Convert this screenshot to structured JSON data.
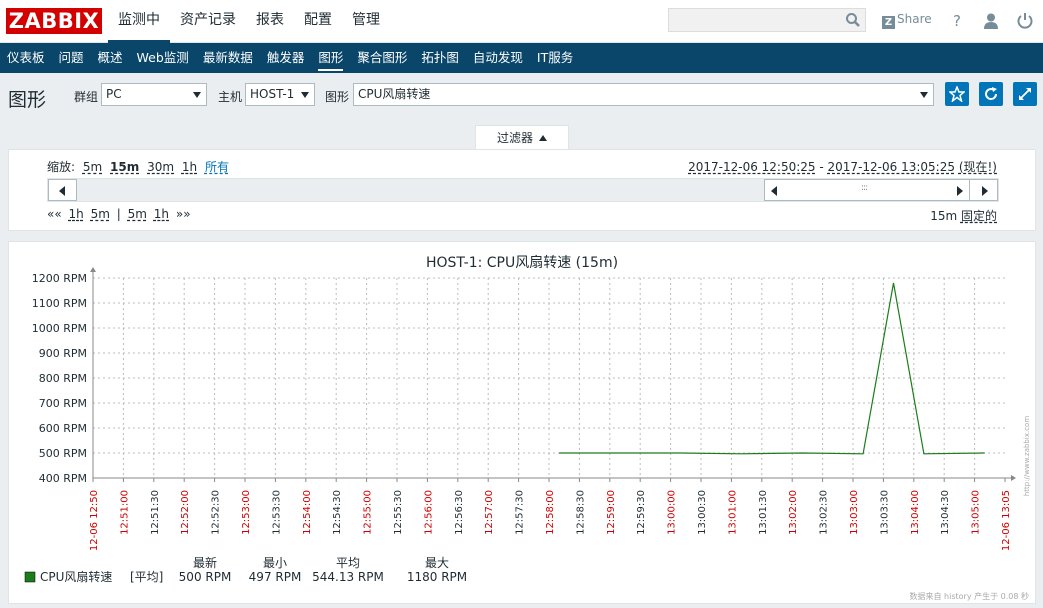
{
  "app": {
    "logo": "ZABBIX",
    "share": "Share",
    "share_badge": "Z"
  },
  "main_menu": [
    {
      "label": "监测中",
      "active": true
    },
    {
      "label": "资产记录",
      "active": false
    },
    {
      "label": "报表",
      "active": false
    },
    {
      "label": "配置",
      "active": false
    },
    {
      "label": "管理",
      "active": false
    }
  ],
  "sub_menu": [
    {
      "label": "仪表板",
      "active": false
    },
    {
      "label": "问题",
      "active": false
    },
    {
      "label": "概述",
      "active": false
    },
    {
      "label": "Web监测",
      "active": false
    },
    {
      "label": "最新数据",
      "active": false
    },
    {
      "label": "触发器",
      "active": false
    },
    {
      "label": "图形",
      "active": true
    },
    {
      "label": "聚合图形",
      "active": false
    },
    {
      "label": "拓扑图",
      "active": false
    },
    {
      "label": "自动发现",
      "active": false
    },
    {
      "label": "IT服务",
      "active": false
    }
  ],
  "header": {
    "title": "图形",
    "group_label": "群组",
    "group_value": "PC",
    "host_label": "主机",
    "host_value": "HOST-1",
    "graph_label": "图形",
    "graph_value": "CPU风扇转速"
  },
  "filter": {
    "tab_label": "过滤器",
    "zoom_label": "缩放:",
    "zoom_options": [
      "5m",
      "15m",
      "30m",
      "1h",
      "所有"
    ],
    "zoom_selected": "15m",
    "time_from": "2017-12-06 12:50:25",
    "time_sep": " - ",
    "time_to": "2017-12-06 13:05:25",
    "time_now": "(现在!)",
    "nav_back": "««",
    "nav_fwd": "»»",
    "nav_left": [
      "1h",
      "5m"
    ],
    "nav_divider": "|",
    "nav_right": [
      "5m",
      "1h"
    ],
    "period": "15m",
    "fixed": "固定的"
  },
  "chart_data": {
    "type": "line",
    "title": "HOST-1: CPU风扇转速 (15m)",
    "ylim": [
      400,
      1200
    ],
    "yticks": [
      "400 RPM",
      "500 RPM",
      "600 RPM",
      "700 RPM",
      "800 RPM",
      "900 RPM",
      "1000 RPM",
      "1100 RPM",
      "1200 RPM"
    ],
    "xticks": [
      {
        "label": "12-06 12:50",
        "major": true
      },
      {
        "label": "12:51:00",
        "major": true
      },
      {
        "label": "12:51:30",
        "major": false
      },
      {
        "label": "12:52:00",
        "major": true
      },
      {
        "label": "12:52:30",
        "major": false
      },
      {
        "label": "12:53:00",
        "major": true
      },
      {
        "label": "12:53:30",
        "major": false
      },
      {
        "label": "12:54:00",
        "major": true
      },
      {
        "label": "12:54:30",
        "major": false
      },
      {
        "label": "12:55:00",
        "major": true
      },
      {
        "label": "12:55:30",
        "major": false
      },
      {
        "label": "12:56:00",
        "major": true
      },
      {
        "label": "12:56:30",
        "major": false
      },
      {
        "label": "12:57:00",
        "major": true
      },
      {
        "label": "12:57:30",
        "major": false
      },
      {
        "label": "12:58:00",
        "major": true
      },
      {
        "label": "12:58:30",
        "major": false
      },
      {
        "label": "12:59:00",
        "major": true
      },
      {
        "label": "12:59:30",
        "major": false
      },
      {
        "label": "13:00:00",
        "major": true
      },
      {
        "label": "13:00:30",
        "major": false
      },
      {
        "label": "13:01:00",
        "major": true
      },
      {
        "label": "13:01:30",
        "major": false
      },
      {
        "label": "13:02:00",
        "major": true
      },
      {
        "label": "13:02:30",
        "major": false
      },
      {
        "label": "13:03:00",
        "major": true
      },
      {
        "label": "13:03:30",
        "major": false
      },
      {
        "label": "13:04:00",
        "major": true
      },
      {
        "label": "13:04:30",
        "major": false
      },
      {
        "label": "13:05:00",
        "major": true
      },
      {
        "label": "12-06 13:05",
        "major": true
      }
    ],
    "series": [
      {
        "name": "CPU风扇转速",
        "color": "#1a7c1a",
        "points": [
          {
            "t": "12:58:05",
            "v": 500
          },
          {
            "t": "12:59:05",
            "v": 500
          },
          {
            "t": "13:00:05",
            "v": 500
          },
          {
            "t": "13:01:05",
            "v": 497
          },
          {
            "t": "13:02:05",
            "v": 500
          },
          {
            "t": "13:03:05",
            "v": 497
          },
          {
            "t": "13:03:35",
            "v": 1180
          },
          {
            "t": "13:04:05",
            "v": 497
          },
          {
            "t": "13:05:05",
            "v": 500
          }
        ]
      }
    ],
    "legend": {
      "name": "CPU风扇转速",
      "func": "[平均]",
      "headers": [
        "最新",
        "最小",
        "平均",
        "最大"
      ],
      "values": [
        "500 RPM",
        "497 RPM",
        "544.13 RPM",
        "1180 RPM"
      ]
    },
    "footer": "数据来自 history 产生于 0.08 秒",
    "watermark": "http://www.zabbix.com"
  }
}
